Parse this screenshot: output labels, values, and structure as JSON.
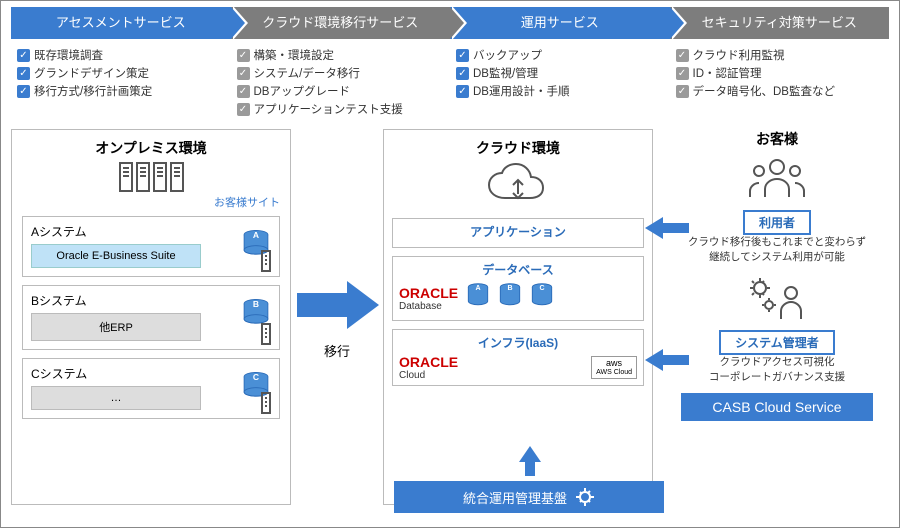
{
  "steps": [
    {
      "label": "アセスメントサービス",
      "color": "blue"
    },
    {
      "label": "クラウド環境移行サービス",
      "color": "gray"
    },
    {
      "label": "運用サービス",
      "color": "blue"
    },
    {
      "label": "セキュリティ対策サービス",
      "color": "gray"
    }
  ],
  "checklists": [
    {
      "color": "blue",
      "items": [
        "既存環境調査",
        "グランドデザイン策定",
        "移行方式/移行計画策定"
      ]
    },
    {
      "color": "gray",
      "items": [
        "構築・環境設定",
        "システム/データ移行",
        "DBアップグレード",
        "アプリケーションテスト支援"
      ]
    },
    {
      "color": "blue",
      "items": [
        "バックアップ",
        "DB監視/管理",
        "DB運用設計・手順"
      ]
    },
    {
      "color": "gray",
      "items": [
        "クラウド利用監視",
        "ID・認証管理",
        "データ暗号化、DB監査など"
      ]
    }
  ],
  "onprem": {
    "title": "オンプレミス環境",
    "site_label": "お客様サイト",
    "systems": [
      {
        "name": "Aシステム",
        "inner": "Oracle E-Business Suite",
        "inner_style": "blue",
        "badge": "A"
      },
      {
        "name": "Bシステム",
        "inner": "他ERP",
        "inner_style": "gray",
        "badge": "B"
      },
      {
        "name": "Cシステム",
        "inner": "…",
        "inner_style": "gray",
        "badge": "C"
      }
    ]
  },
  "migrate_label": "移行",
  "cloud": {
    "title": "クラウド環境",
    "layers": {
      "app": "アプリケーション",
      "db": "データベース",
      "db_brand": "ORACLE",
      "db_sub": "Database",
      "db_badges": [
        "A",
        "B",
        "C"
      ],
      "infra": "インフラ(IaaS)",
      "infra_brand": "ORACLE",
      "infra_sub": "Cloud",
      "aws_top": "aws",
      "aws_bottom": "AWS Cloud"
    }
  },
  "customer": {
    "title": "お客様",
    "user_role": "利用者",
    "user_desc1": "クラウド移行後もこれまでと変わらず",
    "user_desc2": "継続してシステム利用が可能",
    "admin_role": "システム管理者",
    "admin_desc1": "クラウドアクセス可視化",
    "admin_desc2": "コーポレートガバナンス支援"
  },
  "ops_bar": "統合運用管理基盤",
  "casb": "CASB Cloud Service"
}
